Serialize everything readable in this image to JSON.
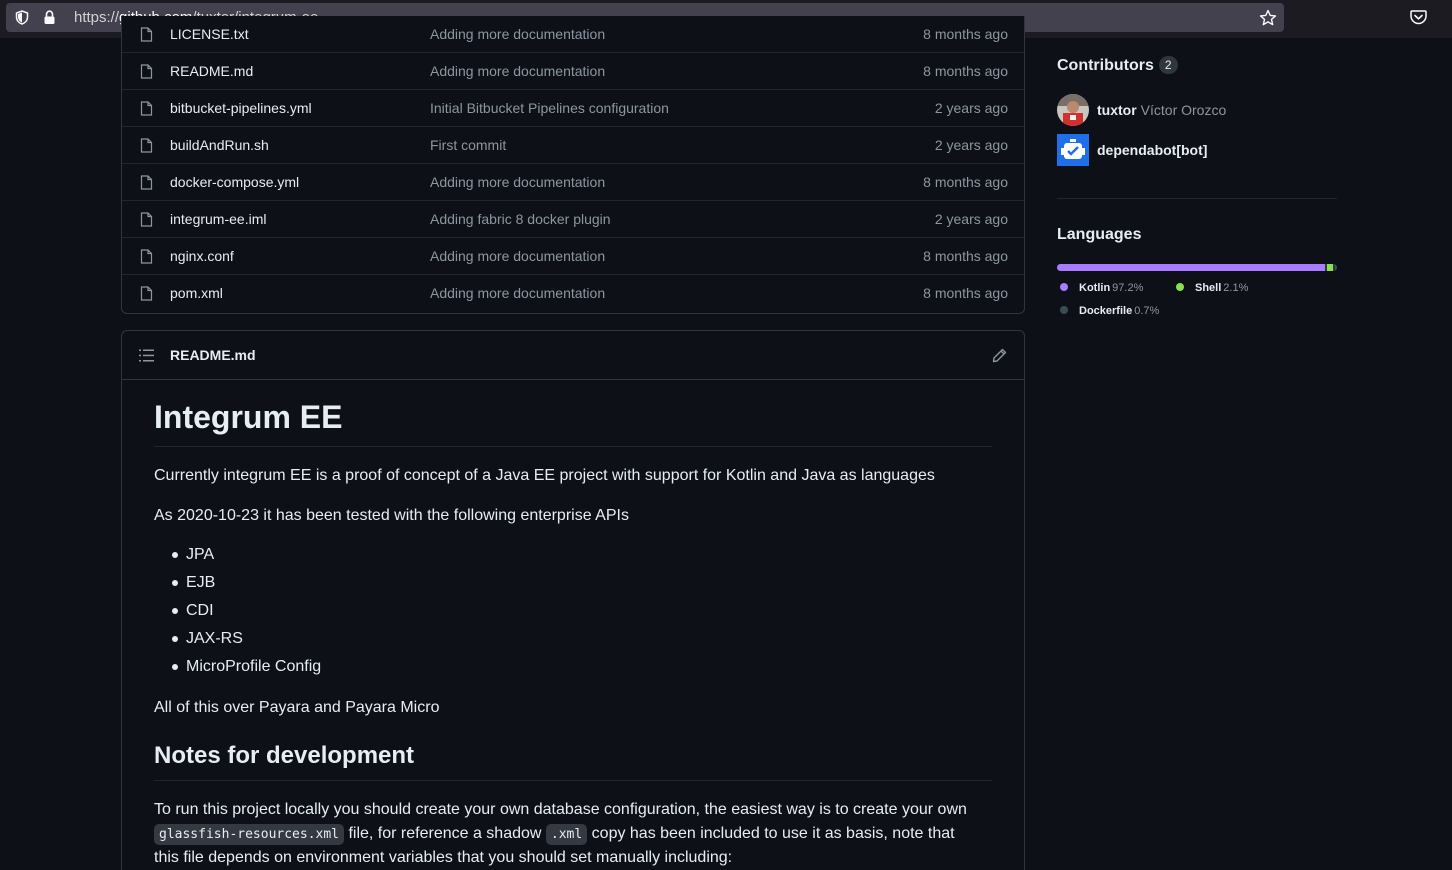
{
  "browser": {
    "url_scheme": "https://",
    "url_host": "github.com",
    "url_path": "/tuxtor/integrum-ee"
  },
  "files": [
    {
      "name": "LICENSE.txt",
      "message": "Adding more documentation",
      "date": "8 months ago"
    },
    {
      "name": "README.md",
      "message": "Adding more documentation",
      "date": "8 months ago"
    },
    {
      "name": "bitbucket-pipelines.yml",
      "message": "Initial Bitbucket Pipelines configuration",
      "date": "2 years ago"
    },
    {
      "name": "buildAndRun.sh",
      "message": "First commit",
      "date": "2 years ago"
    },
    {
      "name": "docker-compose.yml",
      "message": "Adding more documentation",
      "date": "8 months ago"
    },
    {
      "name": "integrum-ee.iml",
      "message": "Adding fabric 8 docker plugin",
      "date": "2 years ago"
    },
    {
      "name": "nginx.conf",
      "message": "Adding more documentation",
      "date": "8 months ago"
    },
    {
      "name": "pom.xml",
      "message": "Adding more documentation",
      "date": "8 months ago"
    }
  ],
  "readme": {
    "filename": "README.md",
    "h1": "Integrum EE",
    "intro": "Currently integrum EE is a proof of concept of a Java EE project with support for Kotlin and Java as languages",
    "tested": "As 2020-10-23 it has been tested with the following enterprise APIs",
    "apis": [
      "JPA",
      "EJB",
      "CDI",
      "JAX-RS",
      "MicroProfile Config"
    ],
    "over": "All of this over Payara and Payara Micro",
    "h2": "Notes for development",
    "dev_line1": "To run this project locally you should create your own database configuration, the easiest way is to create your own",
    "dev_code1": "glassfish-resources.xml",
    "dev_mid1": " file, for reference a shadow ",
    "dev_code2": ".xml",
    "dev_mid2": " copy has been included to use it as basis, note that",
    "dev_line3": "this file depends on environment variables that you should set manually including:"
  },
  "sidebar": {
    "contributors_title": "Contributors",
    "contributors_count": "2",
    "contributors": [
      {
        "login": "tuxtor",
        "name": "Víctor Orozco"
      },
      {
        "login": "dependabot[bot]",
        "name": ""
      }
    ],
    "languages_title": "Languages",
    "languages": [
      {
        "name": "Kotlin",
        "percent": "97.2%",
        "value": 97.2,
        "color": "#a97bff"
      },
      {
        "name": "Shell",
        "percent": "2.1%",
        "value": 2.1,
        "color": "#89e051"
      },
      {
        "name": "Dockerfile",
        "percent": "0.7%",
        "value": 0.7,
        "color": "#384d54"
      }
    ]
  }
}
